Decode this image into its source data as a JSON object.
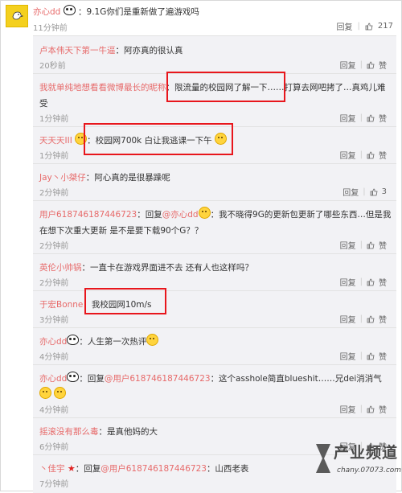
{
  "top": {
    "user": "亦心dd",
    "text": "：9.1G你们是重新做了遍游戏吗",
    "time": "11分钟前",
    "reply_label": "回复",
    "like_count": "217"
  },
  "replies": [
    {
      "user": "卢本伟天下第一牛逼",
      "text": "：阿亦真的很认真",
      "time": "20秒前"
    },
    {
      "user": "我就单纯地想看看微博最长的昵称",
      "text": "：限流量的校园网了解一下……打算去网吧拷了…真鸡儿难受",
      "time": "1分钟前"
    },
    {
      "user": "天天天III",
      "text": "：校园网700k 白让我逃课一下午",
      "time": "1分钟前"
    },
    {
      "user": "Jay丶小桀仔",
      "text": "：阿心真的是很暴躁呢",
      "time": "2分钟前",
      "like_count": "3"
    },
    {
      "user": "用户6187461874467​23",
      "text_pre": "：回复",
      "mention": "@亦心dd",
      "text": "：我不晓得9G的更新包更新了哪些东西…但是我在想下次重大更新 是不是要下载90个G？？",
      "time": "2分钟前"
    },
    {
      "user": "英伦小帅锅",
      "text": "：一直卡在游戏界面进不去 还有人也这样吗？",
      "time": "2分钟前"
    },
    {
      "user": "于宏Bonne",
      "text": "：我校园网10m/s",
      "time": "3分钟前"
    },
    {
      "user": "亦心dd",
      "text": "：人生第一次热评",
      "time": "4分钟前"
    },
    {
      "user": "亦心dd",
      "text_pre": "：回复",
      "mention": "@用户618746187446723",
      "text": "：这个asshole简直blueshit……兄dei消消气",
      "time": "4分钟前"
    },
    {
      "user": "摇滚没有那么毒",
      "text": "：是真他妈的大",
      "time": "6分钟前"
    },
    {
      "user": "丶佳宇",
      "text_pre": "：回复",
      "mention": "@用户618746187446723",
      "text": "：山西老表",
      "time": "7分钟前"
    }
  ],
  "labels": {
    "reply": "回复",
    "like": "赞"
  },
  "watermark": {
    "title": "产业频道",
    "subtitle": "chany.07073.com"
  }
}
